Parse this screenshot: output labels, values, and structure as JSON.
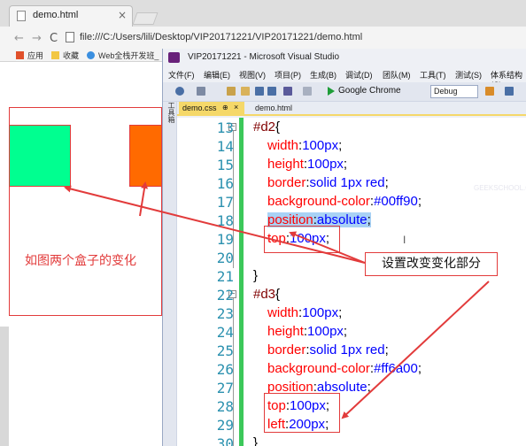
{
  "browser": {
    "tab_title": "demo.html",
    "tab_close": "×",
    "nav": {
      "back": "←",
      "forward": "→",
      "reload": "C"
    },
    "url": "file:///C:/Users/lili/Desktop/VIP20171221/VIP20171221/demo.html",
    "bookmarks": [
      "应用",
      "收藏",
      "Web全栈开发班_"
    ]
  },
  "page": {
    "caption": "如图两个盒子的变化",
    "box_colors": {
      "d2": "#00ff90",
      "d3": "#ff6a00",
      "border": "#e23b3b"
    }
  },
  "vs": {
    "title": "VIP20171221 - Microsoft Visual Studio",
    "menu": [
      "文件(F)",
      "编辑(E)",
      "视图(V)",
      "项目(P)",
      "生成(B)",
      "调试(D)",
      "团队(M)",
      "工具(T)",
      "测试(S)",
      "体系结构(C)"
    ],
    "run_label": "Google Chrome",
    "config": "Debug",
    "side_label": "工具箱",
    "tabs": {
      "active": "demo.css",
      "pin": "⊕",
      "close": "×",
      "other": "demo.html"
    },
    "ghost_text": "GEEKSCHOOL.COM",
    "caret": "I",
    "fold_marks": {
      "a": "−",
      "b": "−"
    }
  },
  "code": {
    "lines": [
      {
        "n": "13",
        "sel": "#d2",
        "brace": "{"
      },
      {
        "n": "14",
        "prop": "width",
        "val": "100px"
      },
      {
        "n": "15",
        "prop": "height",
        "val": "100px"
      },
      {
        "n": "16",
        "prop": "border",
        "val": "solid 1px red"
      },
      {
        "n": "17",
        "prop": "background-color",
        "val": "#00ff90"
      },
      {
        "n": "18",
        "prop": "position",
        "val": "absolute"
      },
      {
        "n": "19",
        "prop": "top",
        "val": "100px"
      },
      {
        "n": "20"
      },
      {
        "n": "21",
        "brace": "}"
      },
      {
        "n": "22",
        "sel": "#d3",
        "brace": "{"
      },
      {
        "n": "23",
        "prop": "width",
        "val": "100px"
      },
      {
        "n": "24",
        "prop": "height",
        "val": "100px"
      },
      {
        "n": "25",
        "prop": "border",
        "val": "solid 1px red"
      },
      {
        "n": "26",
        "prop": "background-color",
        "val": "#ff6a00"
      },
      {
        "n": "27",
        "prop": "position",
        "val": "absolute"
      },
      {
        "n": "28",
        "prop": "top",
        "val": "100px"
      },
      {
        "n": "29",
        "prop": "left",
        "val": "200px"
      },
      {
        "n": "30",
        "brace": "}"
      }
    ]
  },
  "annotation": {
    "label": "设置改变变化部分",
    "color": "#e23b3b"
  }
}
